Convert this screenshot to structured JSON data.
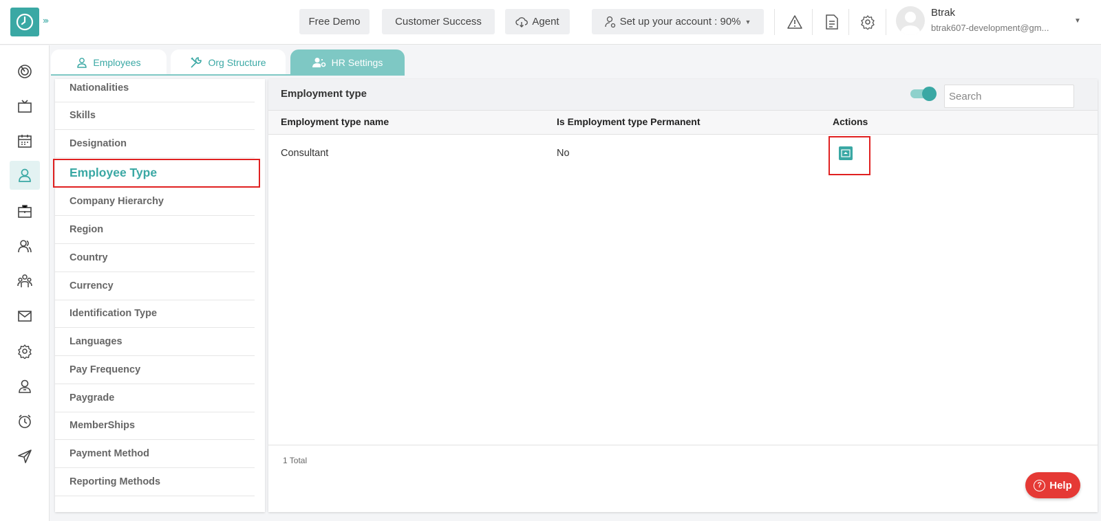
{
  "header": {
    "free_demo": "Free Demo",
    "customer_success": "Customer Success",
    "agent": "Agent",
    "setup_account": "Set up your account : 90%",
    "user_name": "Btrak",
    "user_email": "btrak607-development@gm..."
  },
  "tabs": [
    {
      "label": "Employees",
      "icon": "person-icon"
    },
    {
      "label": "Org Structure",
      "icon": "tools-icon"
    },
    {
      "label": "HR Settings",
      "icon": "users-settings-icon"
    }
  ],
  "settings_list": [
    "Nationalities",
    "Skills",
    "Designation",
    "Employee Type",
    "Company Hierarchy",
    "Region",
    "Country",
    "Currency",
    "Identification Type",
    "Languages",
    "Pay Frequency",
    "Paygrade",
    "MemberShips",
    "Payment Method",
    "Reporting Methods"
  ],
  "active_setting": "Employee Type",
  "main": {
    "title": "Employment type",
    "search_placeholder": "Search",
    "archive_toggle_on": true,
    "columns": [
      "Employment type name",
      "Is Employment type Permanent",
      "Actions"
    ],
    "rows": [
      {
        "name": "Consultant",
        "permanent": "No"
      }
    ],
    "total": "1 Total"
  },
  "help": "Help",
  "colors": {
    "accent": "#3aa8a4",
    "highlight": "#e02020",
    "help": "#e53935"
  }
}
